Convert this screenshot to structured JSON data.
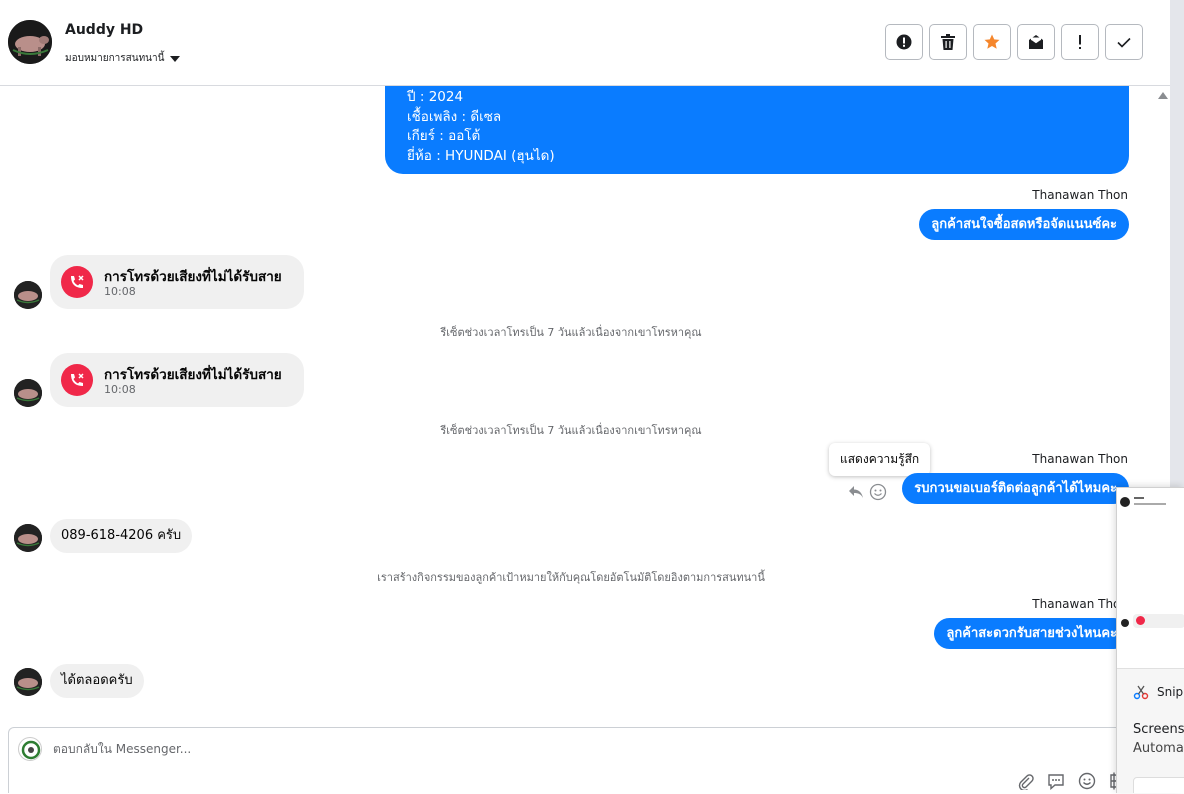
{
  "header": {
    "contact_name": "Auddy HD",
    "assign_label": "มอบหมายการสนทนานี้",
    "toolbar": [
      {
        "icon": "alert-circle-icon",
        "label": "spam"
      },
      {
        "icon": "trash-icon",
        "label": "delete"
      },
      {
        "icon": "star-icon",
        "label": "star"
      },
      {
        "icon": "mark-unread-icon",
        "label": "mark unread"
      },
      {
        "icon": "exclamation-icon",
        "label": "follow up"
      },
      {
        "icon": "check-icon",
        "label": "done"
      }
    ]
  },
  "messages": {
    "info": {
      "year": "ปี : 2024",
      "fuel": "เชื้อเพลิง : ดีเซล",
      "gear": "เกียร์ : ออโต้",
      "brand": "ยี่ห้อ : HYUNDAI (ฮุนได)"
    },
    "out1": {
      "sender": "Thanawan Thon",
      "text": "ลูกค้าสนใจซื้อสดหรือจัดแนนซ์คะ"
    },
    "call1": {
      "title": "การโทรด้วยเสียงที่ไม่ได้รับสาย",
      "time": "10:08"
    },
    "note1": "รีเซ็ตช่วงเวลาโทรเป็น 7 วันแล้วเนื่องจากเขาโทรหาคุณ",
    "call2": {
      "title": "การโทรด้วยเสียงที่ไม่ได้รับสาย",
      "time": "10:08"
    },
    "note2": "รีเซ็ตช่วงเวลาโทรเป็น 7 วันแล้วเนื่องจากเขาโทรหาคุณ",
    "tooltip": "แสดงความรู้สึก",
    "out2": {
      "sender": "Thanawan Thon",
      "text": "รบกวนขอเบอร์ติดต่อลูกค้าได้ไหมคะ"
    },
    "in1": "089-618-4206 ครับ",
    "note3": "เราสร้างกิจกรรมของลูกค้าเป้าหมายให้กับคุณโดยอัตโนมัติโดยอิงตามการสนทนานี้",
    "out3": {
      "sender": "Thanawan Thon",
      "text": "ลูกค้าสะดวกรับสายช่วงไหนคะ"
    },
    "in2": "ได้ตลอดครับ"
  },
  "composer": {
    "placeholder": "ตอบกลับใน Messenger..."
  },
  "snip": {
    "app": "Snipp",
    "title": "Screensh",
    "subtitle": "Automat"
  },
  "colors": {
    "outgoing": "#0a7cff",
    "incoming": "#f0f0f0",
    "missed_call": "#f02849",
    "star": "#f5862c"
  }
}
